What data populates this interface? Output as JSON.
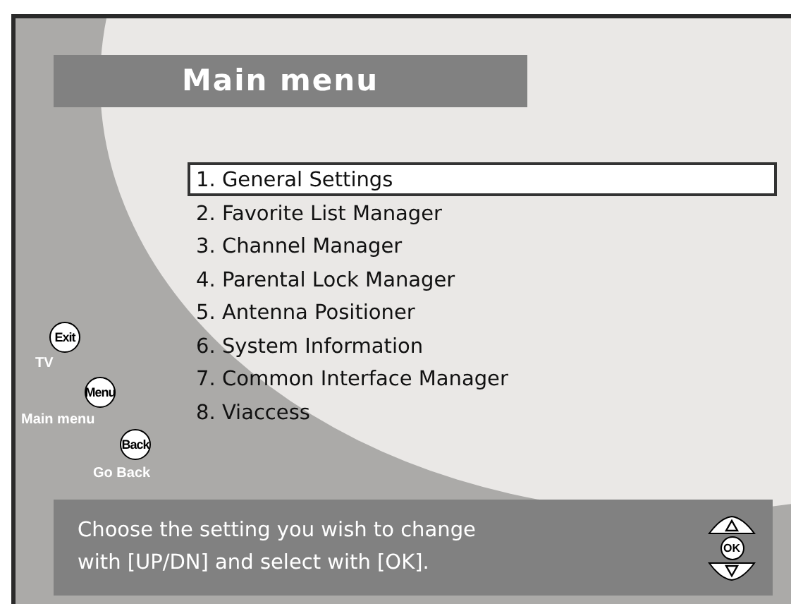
{
  "title": "Main menu",
  "menu_items": [
    {
      "label": "1. General Settings",
      "selected": true
    },
    {
      "label": "2. Favorite List Manager",
      "selected": false
    },
    {
      "label": "3. Channel Manager",
      "selected": false
    },
    {
      "label": "4. Parental Lock Manager",
      "selected": false
    },
    {
      "label": "5. Antenna Positioner",
      "selected": false
    },
    {
      "label": "6. System Information",
      "selected": false
    },
    {
      "label": "7. Common Interface Manager",
      "selected": false
    },
    {
      "label": "8. Viaccess",
      "selected": false
    }
  ],
  "key_legend": [
    {
      "key": "Exit",
      "label": "TV"
    },
    {
      "key": "Menu",
      "label": "Main menu"
    },
    {
      "key": "Back",
      "label": "Go Back"
    }
  ],
  "hint_lines": [
    "Choose the setting you wish to change",
    "with [UP/DN] and select with [OK]."
  ],
  "nav_keys": {
    "ok": "OK"
  }
}
